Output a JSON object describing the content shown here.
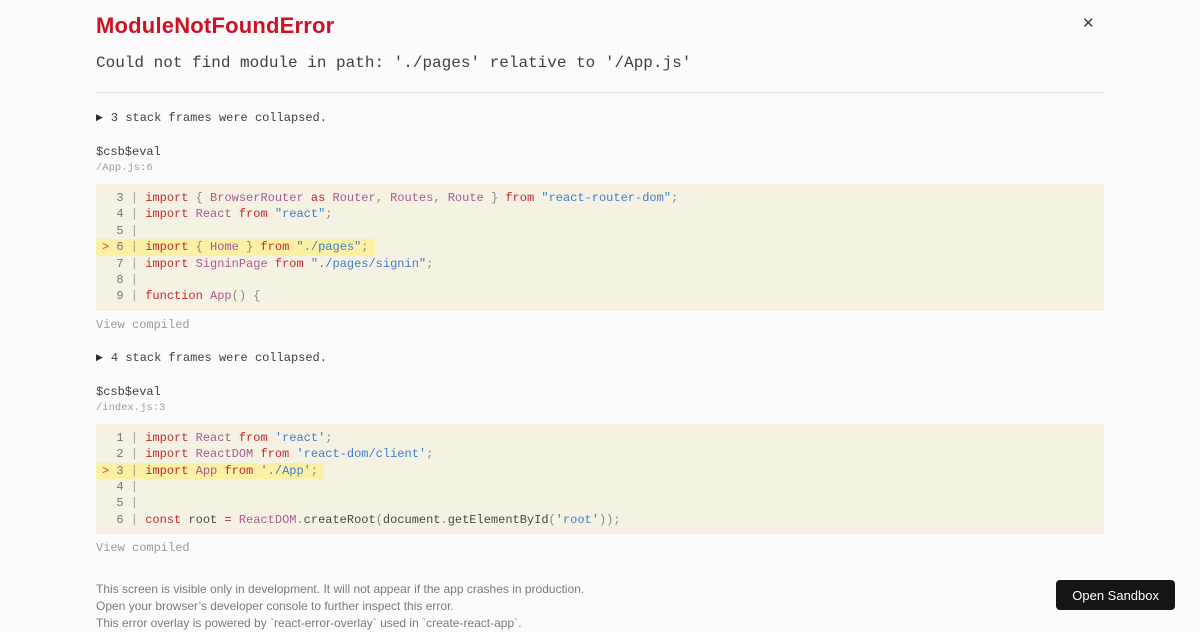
{
  "overlay": {
    "title": "ModuleNotFoundError",
    "close_icon": "✕",
    "message": "Could not find module in path: './pages' relative to '/App.js'"
  },
  "sections": [
    {
      "collapse_icon": "▶",
      "collapsed_label": "3 stack frames were collapsed.",
      "function_name": "$csb$eval",
      "location": "/App.js:6",
      "view_compiled_label": "View compiled",
      "lines": [
        {
          "num": 3,
          "highlight": false,
          "tokens": [
            [
              "kw",
              "import"
            ],
            [
              "pun",
              " { "
            ],
            [
              "id",
              "BrowserRouter"
            ],
            [
              "kw",
              " as "
            ],
            [
              "id",
              "Router"
            ],
            [
              "pun",
              ", "
            ],
            [
              "id",
              "Routes"
            ],
            [
              "pun",
              ", "
            ],
            [
              "id",
              "Route"
            ],
            [
              "pun",
              " } "
            ],
            [
              "kw",
              "from"
            ],
            [
              "pl",
              " "
            ],
            [
              "str",
              "\"react-router-dom\""
            ],
            [
              "pun",
              ";"
            ]
          ]
        },
        {
          "num": 4,
          "highlight": false,
          "tokens": [
            [
              "kw",
              "import"
            ],
            [
              "pl",
              " "
            ],
            [
              "id",
              "React"
            ],
            [
              "kw",
              " from "
            ],
            [
              "str",
              "\"react\""
            ],
            [
              "pun",
              ";"
            ]
          ]
        },
        {
          "num": 5,
          "highlight": false,
          "tokens": []
        },
        {
          "num": 6,
          "highlight": true,
          "tokens": [
            [
              "kw",
              "import"
            ],
            [
              "pun",
              " { "
            ],
            [
              "id",
              "Home"
            ],
            [
              "pun",
              " } "
            ],
            [
              "kw",
              "from"
            ],
            [
              "pl",
              " "
            ],
            [
              "str",
              "\"./pages\""
            ],
            [
              "pun",
              ";"
            ]
          ]
        },
        {
          "num": 7,
          "highlight": false,
          "tokens": [
            [
              "kw",
              "import"
            ],
            [
              "pl",
              " "
            ],
            [
              "id",
              "SigninPage"
            ],
            [
              "kw",
              " from "
            ],
            [
              "str",
              "\"./pages/signin\""
            ],
            [
              "pun",
              ";"
            ]
          ]
        },
        {
          "num": 8,
          "highlight": false,
          "tokens": []
        },
        {
          "num": 9,
          "highlight": false,
          "tokens": [
            [
              "kw",
              "function"
            ],
            [
              "pl",
              " "
            ],
            [
              "id",
              "App"
            ],
            [
              "pun",
              "() {"
            ]
          ]
        }
      ]
    },
    {
      "collapse_icon": "▶",
      "collapsed_label": "4 stack frames were collapsed.",
      "function_name": "$csb$eval",
      "location": "/index.js:3",
      "view_compiled_label": "View compiled",
      "lines": [
        {
          "num": 1,
          "highlight": false,
          "tokens": [
            [
              "kw",
              "import"
            ],
            [
              "pl",
              " "
            ],
            [
              "id",
              "React"
            ],
            [
              "kw",
              " from "
            ],
            [
              "str",
              "'react'"
            ],
            [
              "pun",
              ";"
            ]
          ]
        },
        {
          "num": 2,
          "highlight": false,
          "tokens": [
            [
              "kw",
              "import"
            ],
            [
              "pl",
              " "
            ],
            [
              "id",
              "ReactDOM"
            ],
            [
              "kw",
              " from "
            ],
            [
              "str",
              "'react-dom/client'"
            ],
            [
              "pun",
              ";"
            ]
          ]
        },
        {
          "num": 3,
          "highlight": true,
          "tokens": [
            [
              "kw",
              "import"
            ],
            [
              "pl",
              " "
            ],
            [
              "id",
              "App"
            ],
            [
              "kw",
              " from "
            ],
            [
              "str",
              "'./App'"
            ],
            [
              "pun",
              ";"
            ]
          ]
        },
        {
          "num": 4,
          "highlight": false,
          "tokens": []
        },
        {
          "num": 5,
          "highlight": false,
          "tokens": []
        },
        {
          "num": 6,
          "highlight": false,
          "tokens": [
            [
              "kw",
              "const"
            ],
            [
              "pl",
              " root "
            ],
            [
              "kw",
              "="
            ],
            [
              "pl",
              " "
            ],
            [
              "id",
              "ReactDOM"
            ],
            [
              "pun",
              "."
            ],
            [
              "pl",
              "createRoot"
            ],
            [
              "pun",
              "("
            ],
            [
              "pl",
              "document"
            ],
            [
              "pun",
              "."
            ],
            [
              "pl",
              "getElementById"
            ],
            [
              "pun",
              "("
            ],
            [
              "str",
              "'root'"
            ],
            [
              "pun",
              "));"
            ]
          ]
        }
      ]
    }
  ],
  "footer": {
    "lines": [
      "This screen is visible only in development. It will not appear if the app crashes in production.",
      "Open your browser’s developer console to further inspect this error.",
      "This error overlay is powered by `react-error-overlay` used in `create-react-app`."
    ],
    "open_sandbox_label": "Open Sandbox"
  },
  "colors": {
    "title_red": "#ce1126",
    "keyword_red": "#c5292e",
    "identifier_purple": "#aa5a93",
    "string_blue": "#3f7ecc",
    "code_background": "#f6f2e3",
    "highlight_yellow": "#fbf0a4",
    "button_black": "#151515",
    "page_background": "#fbfbfb"
  }
}
